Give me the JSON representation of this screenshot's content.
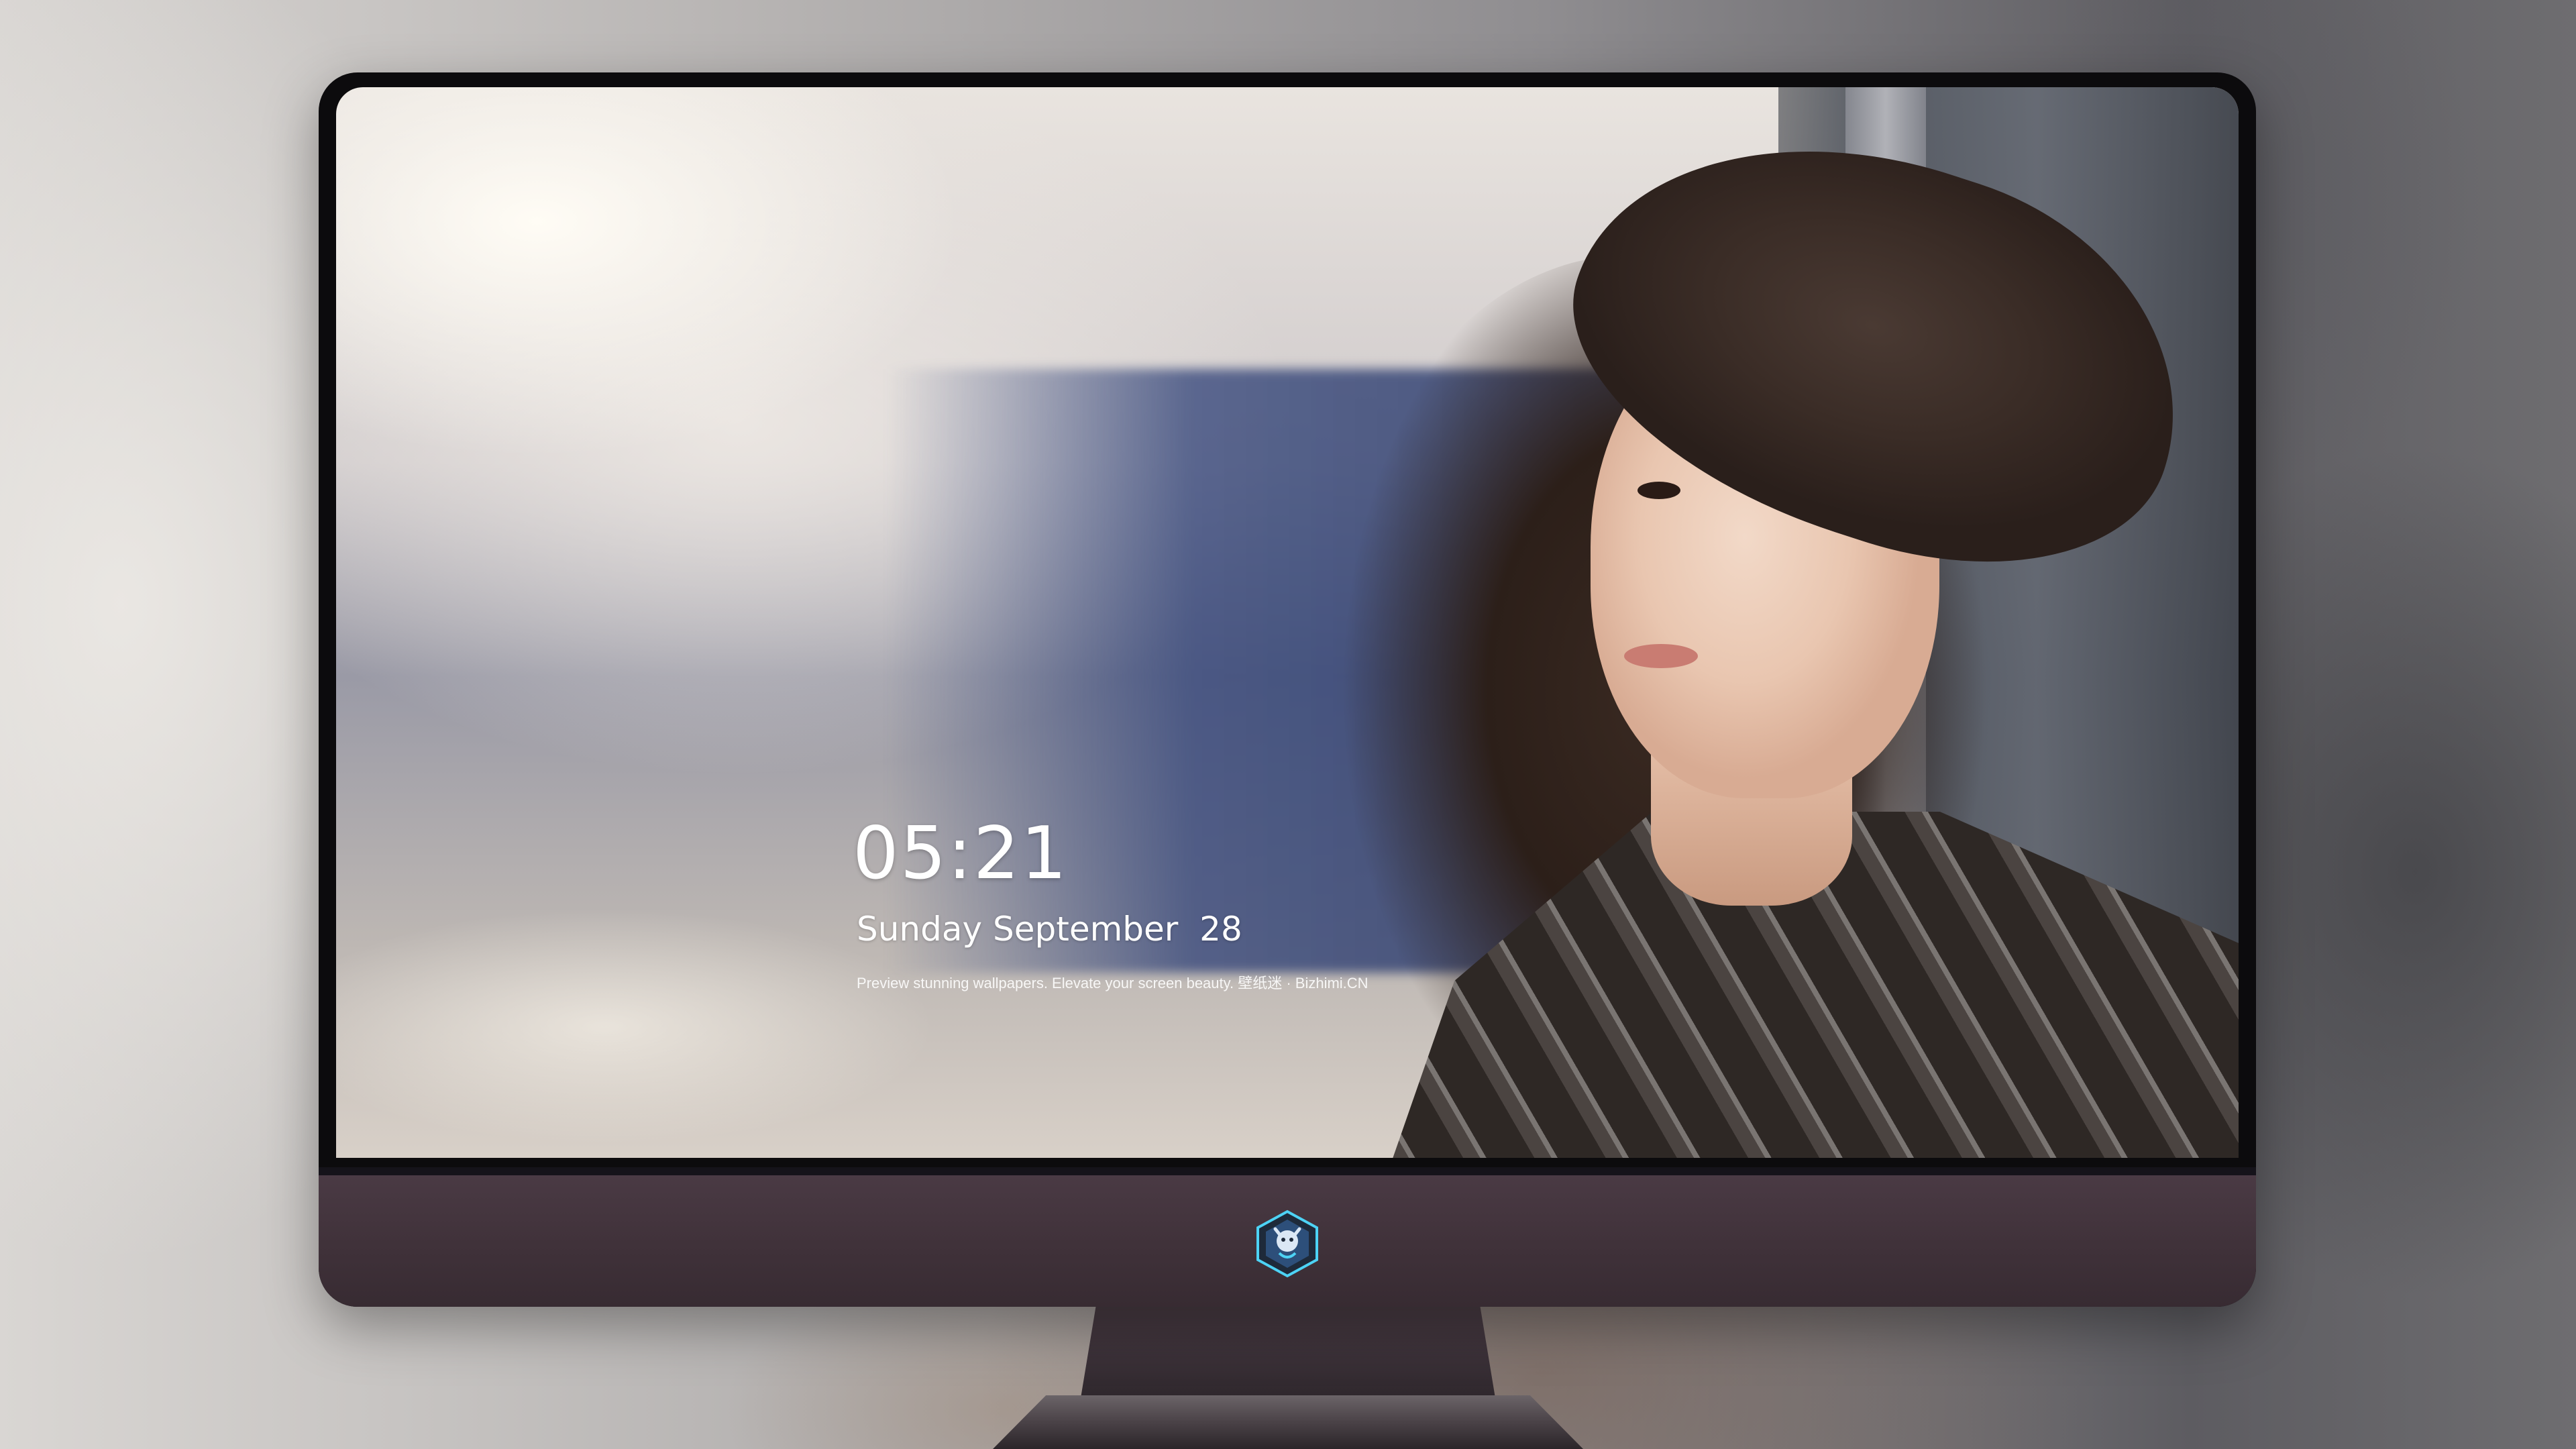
{
  "lock_screen": {
    "time": "05:21",
    "date": "Sunday September  28",
    "tagline": "Preview stunning wallpapers. Elevate your screen beauty. 壁纸迷 · Bizhimi.CN"
  },
  "dock": {
    "apps": [
      {
        "icon": "messages-icon",
        "color": "#34c759"
      },
      {
        "icon": "weather-icon",
        "color": "#2f8ef5"
      },
      {
        "icon": "clock-icon",
        "color": "#1c1c1e"
      },
      {
        "icon": "preview-icon",
        "color": "#e8c34a"
      },
      {
        "icon": "clips-icon",
        "color": "#48b8e8"
      },
      {
        "icon": "notes-icon",
        "color": "#f7d154"
      },
      {
        "icon": "photo-booth-icon",
        "color": "#ecebe8"
      },
      {
        "icon": "music-icon",
        "color": "#ea4fa8"
      },
      {
        "icon": "app-store-icon",
        "color": "#1a8ff2"
      },
      {
        "icon": "camera-icon",
        "color": "#8e8e93"
      }
    ]
  },
  "colors": {
    "monitor_chin": "#3f3139",
    "bezel": "#0c0b0d"
  }
}
